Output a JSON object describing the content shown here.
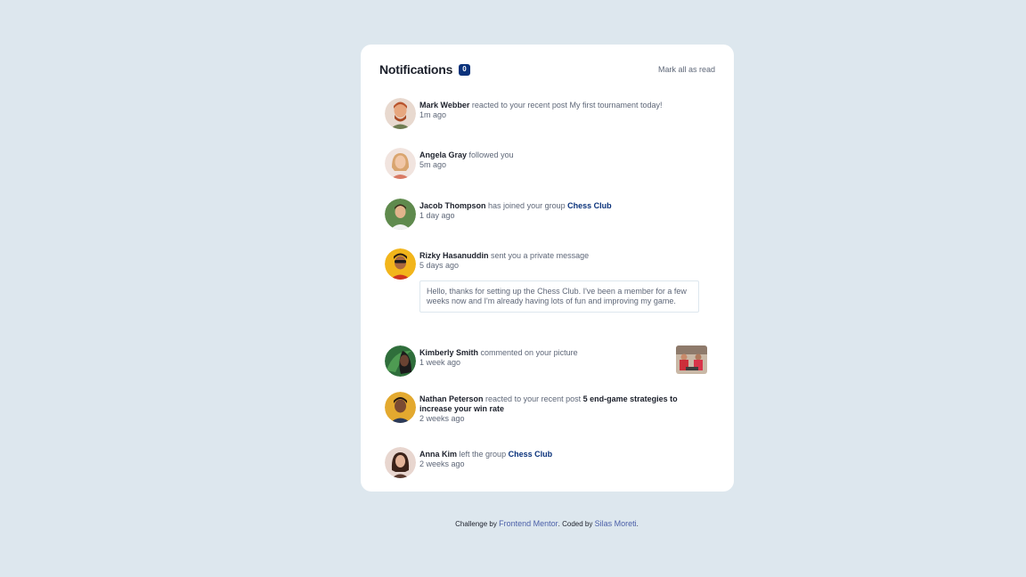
{
  "header": {
    "title": "Notifications",
    "unread_count": "0",
    "mark_all_label": "Mark all as read"
  },
  "notifications": [
    {
      "name": "Mark Webber",
      "action": "reacted to your recent post",
      "post": "My first tournament today!",
      "time": "1m ago"
    },
    {
      "name": "Angela Gray",
      "action": "followed you",
      "time": "5m ago"
    },
    {
      "name": "Jacob Thompson",
      "action": "has joined your group",
      "group": "Chess Club",
      "time": "1 day ago"
    },
    {
      "name": "Rizky Hasanuddin",
      "action": "sent you a private message",
      "time": "5 days ago",
      "message": "Hello, thanks for setting up the Chess Club. I've been a member for a few weeks now and I'm already having lots of fun and improving my game."
    },
    {
      "name": "Kimberly Smith",
      "action": "commented on your picture",
      "time": "1 week ago"
    },
    {
      "name": "Nathan Peterson",
      "action": "reacted to your recent post",
      "post": "5 end-game strategies to increase your win rate",
      "time": "2 weeks ago"
    },
    {
      "name": "Anna Kim",
      "action": "left the group",
      "group": "Chess Club",
      "time": "2 weeks ago"
    }
  ],
  "footer": {
    "challenge_by": "Challenge by",
    "frontend_mentor": "Frontend Mentor",
    "coded_by": ". Coded by",
    "author": "Silas Moreti",
    "end": "."
  },
  "colors": {
    "background": "#dde7ee",
    "card": "#ffffff",
    "badge": "#0a327b",
    "group_link": "#0a327b",
    "text_dark": "#1c202b",
    "text_muted": "#5e6778"
  },
  "icons": {
    "avatars": [
      "mark-webber-avatar",
      "angela-gray-avatar",
      "jacob-thompson-avatar",
      "rizky-hasanuddin-avatar",
      "kimberly-smith-avatar",
      "nathan-peterson-avatar",
      "anna-kim-avatar"
    ],
    "picture": "chess-picture-thumbnail"
  }
}
